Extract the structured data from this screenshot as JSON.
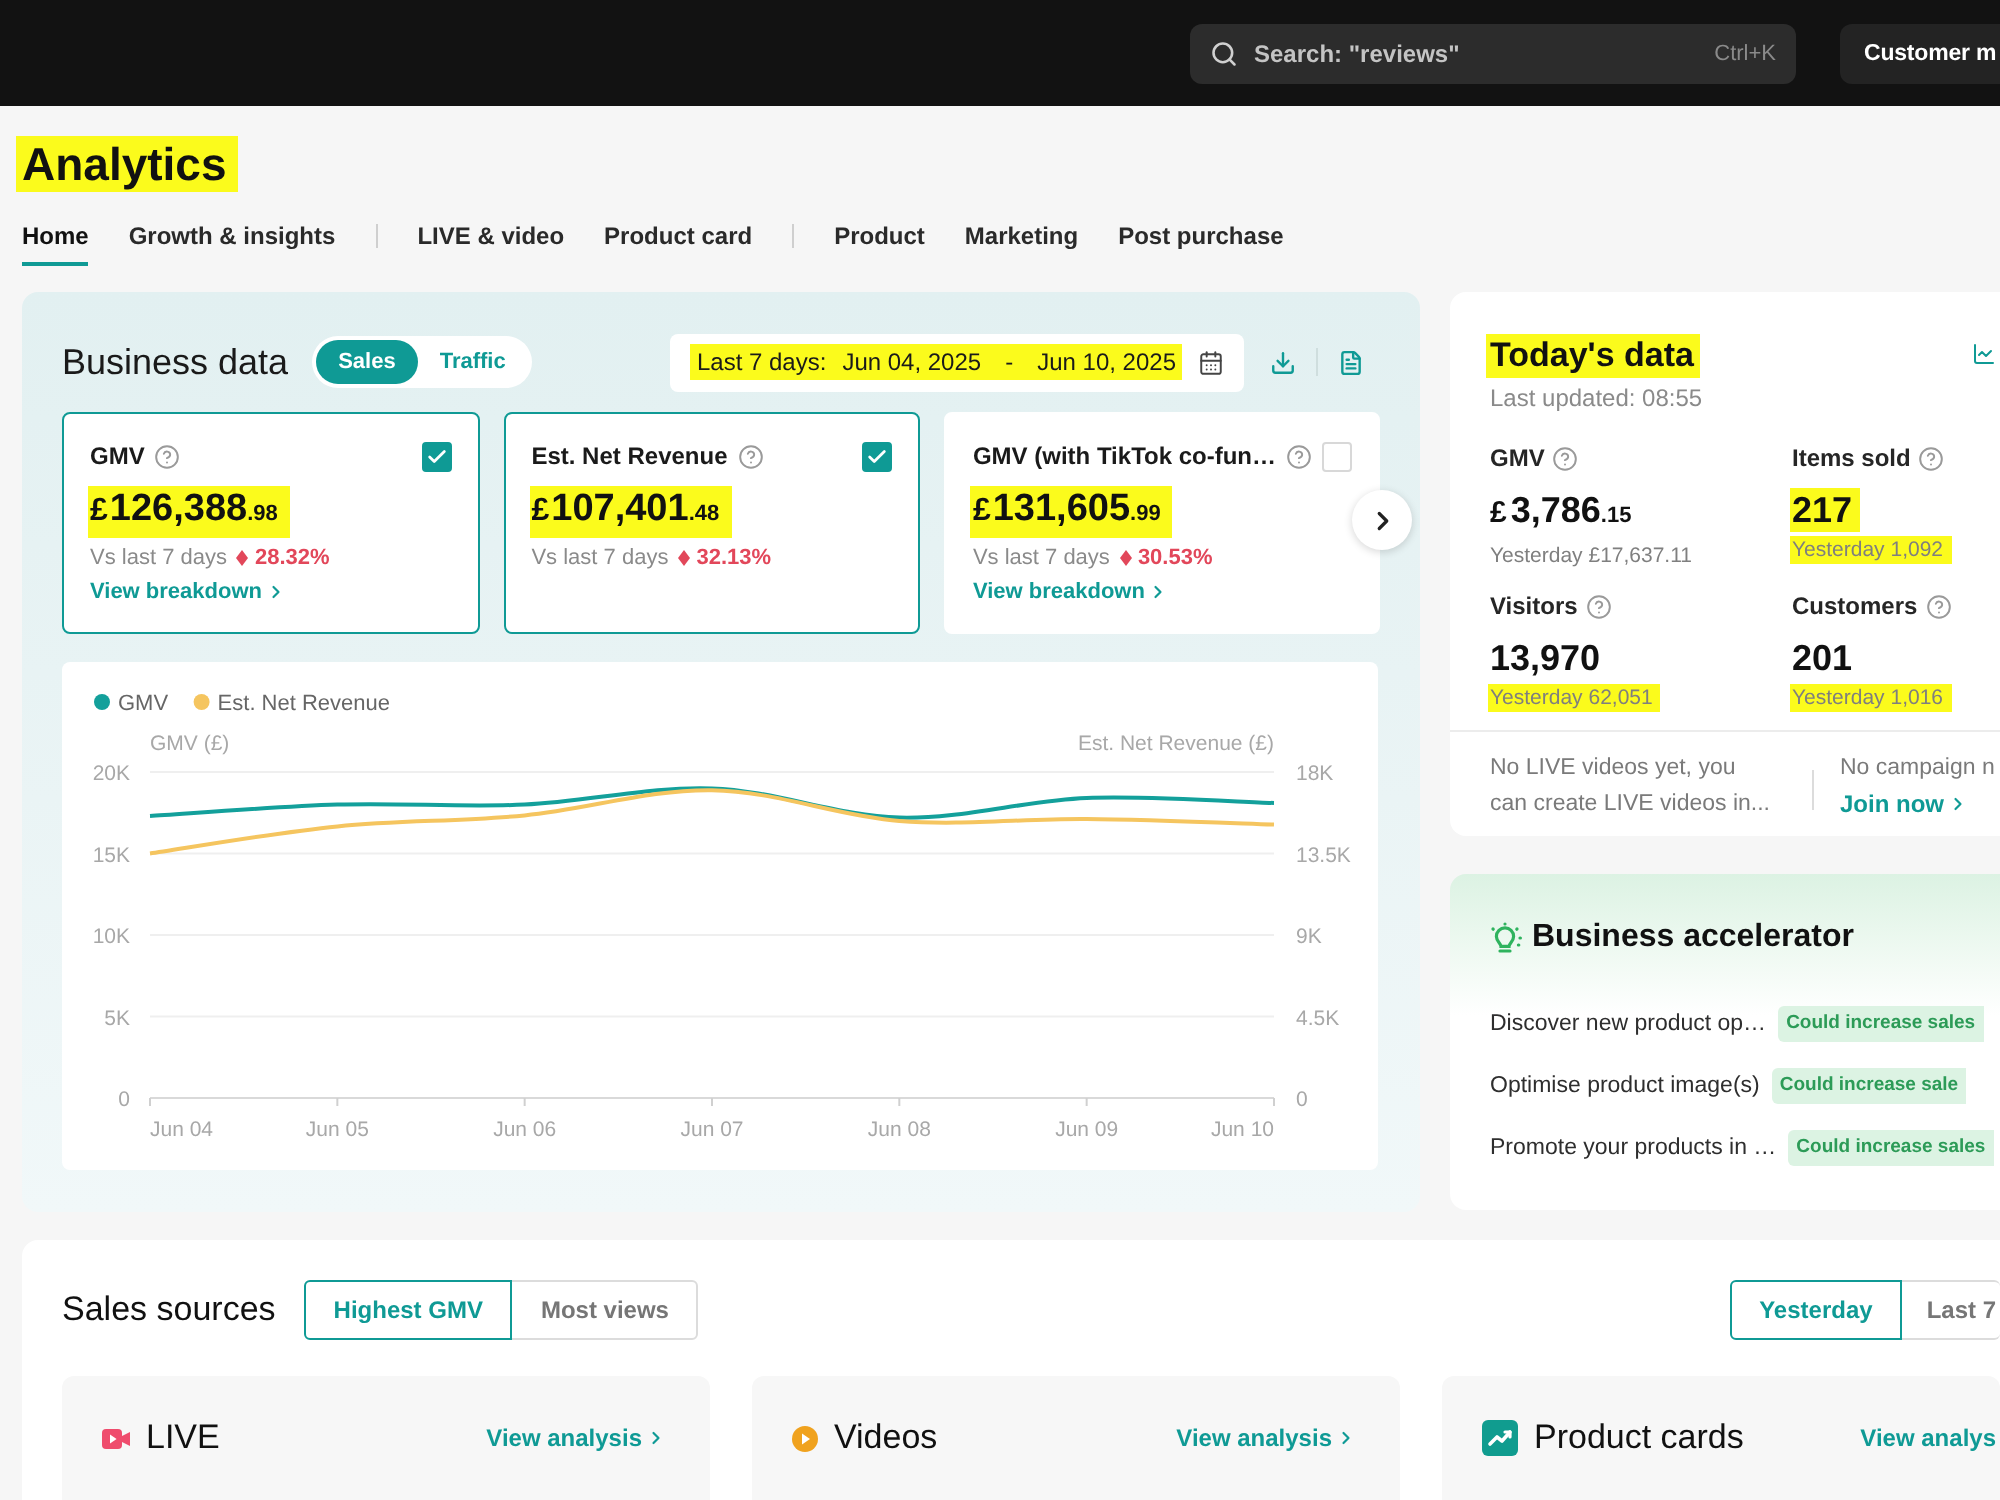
{
  "top_bar": {
    "search": {
      "placeholder": "Search: \"reviews\"",
      "shortcut": "Ctrl+K"
    },
    "button": "Customer m"
  },
  "page_title": {
    "text": "Analytics",
    "highlighted": true
  },
  "tab_groups": [
    [
      {
        "label": "Home",
        "selected": true
      },
      {
        "label": "Growth & insights",
        "selected": false
      }
    ],
    [
      {
        "label": "LIVE & video",
        "selected": false
      },
      {
        "label": "Product card",
        "selected": false
      }
    ],
    [
      {
        "label": "Product",
        "selected": false
      },
      {
        "label": "Marketing",
        "selected": false
      },
      {
        "label": "Post purchase",
        "selected": false
      }
    ]
  ],
  "business_data": {
    "title": "Business data",
    "modes": [
      {
        "label": "Sales",
        "selected": true
      },
      {
        "label": "Traffic",
        "selected": false
      }
    ],
    "date_range": {
      "label": "Last 7 days:",
      "start": "Jun 04, 2025",
      "separator": "-",
      "end": "Jun 10, 2025",
      "highlighted": true
    },
    "metrics": [
      {
        "label": "GMV",
        "currency": "£",
        "value": "126,388",
        "decimals": ".98",
        "highlighted": true,
        "comparison": "Vs last 7 days",
        "change": "28.32%",
        "link": "View breakdown",
        "checked": true
      },
      {
        "label": "Est. Net Revenue",
        "currency": "£",
        "value": "107,401",
        "decimals": ".48",
        "highlighted": true,
        "comparison": "Vs last 7 days",
        "change": "32.13%",
        "checked": true
      },
      {
        "label": "GMV (with TikTok co-fun…",
        "currency": "£",
        "value": "131,605",
        "decimals": ".99",
        "highlighted": true,
        "comparison": "Vs last 7 days",
        "change": "30.53%",
        "link": "View breakdown",
        "checked": false
      }
    ],
    "chart": {
      "chart_data": {
        "type": "line",
        "legend": "top-left",
        "grid": true,
        "categories": [
          "Jun 04",
          "Jun 05",
          "Jun 06",
          "Jun 07",
          "Jun 08",
          "Jun 09",
          "Jun 10"
        ],
        "ylabel": "GMV (£)",
        "y2label": "Est. Net Revenue (£)",
        "ylim": [
          0,
          20000
        ],
        "y2lim": [
          0,
          18000
        ],
        "yticks": [
          {
            "value": 0,
            "label": "0"
          },
          {
            "value": 5000,
            "label": "5K"
          },
          {
            "value": 10000,
            "label": "10K"
          },
          {
            "value": 15000,
            "label": "15K"
          },
          {
            "value": 20000,
            "label": "20K"
          }
        ],
        "y2ticks": [
          {
            "value": 0,
            "label": "0"
          },
          {
            "value": 4500,
            "label": "4.5K"
          },
          {
            "value": 9000,
            "label": "9K"
          },
          {
            "value": 13500,
            "label": "13.5K"
          },
          {
            "value": 18000,
            "label": "18K"
          }
        ],
        "series": [
          {
            "name": "GMV",
            "color": "#13a09b",
            "values": [
              17300,
              18000,
              18000,
              19000,
              17200,
              18400,
              18100
            ]
          },
          {
            "name": "Est. Net Revenue",
            "color": "#f5c55f",
            "axis": "y2",
            "values": [
              13500,
              15000,
              15600,
              17000,
              15300,
              15400,
              15100
            ]
          }
        ]
      }
    }
  },
  "todays_data": {
    "title": {
      "text": "Today's data",
      "highlighted": true
    },
    "updated": "Last updated: 08:55",
    "stats": [
      {
        "label": "GMV",
        "currency": "£",
        "value": "3,786",
        "decimals": ".15",
        "value_highlighted": false,
        "yesterday": "Yesterday £17,637.11",
        "yesterday_highlighted": false
      },
      {
        "label": "Items sold",
        "value": "217",
        "value_highlighted": true,
        "yesterday": "Yesterday 1,092",
        "yesterday_highlighted": true
      },
      {
        "label": "Visitors",
        "value": "13,970",
        "value_highlighted": false,
        "yesterday": "Yesterday 62,051",
        "yesterday_highlighted": true
      },
      {
        "label": "Customers",
        "value": "201",
        "value_highlighted": false,
        "yesterday": "Yesterday 1,016",
        "yesterday_highlighted": true
      }
    ],
    "notes": [
      {
        "text": "No LIVE videos yet, you can create LIVE videos in..."
      },
      {
        "text": "No campaign n",
        "link": "Join now"
      }
    ]
  },
  "business_accelerator": {
    "title": "Business accelerator",
    "items": [
      {
        "text": "Discover new product op…",
        "badge": "Could increase sales"
      },
      {
        "text": "Optimise product image(s)",
        "badge": "Could increase sale"
      },
      {
        "text": "Promote your products in …",
        "badge": "Could increase sales"
      }
    ]
  },
  "sales_sources": {
    "title": "Sales sources",
    "sort": [
      {
        "label": "Highest GMV",
        "selected": true
      },
      {
        "label": "Most views",
        "selected": false
      }
    ],
    "period": [
      {
        "label": "Yesterday",
        "selected": true
      },
      {
        "label": "Last 7",
        "selected": false
      }
    ],
    "sources": [
      {
        "kind": "live",
        "title": "LIVE",
        "link": "View analysis",
        "chevron": true
      },
      {
        "kind": "videos",
        "title": "Videos",
        "link": "View analysis",
        "chevron": true
      },
      {
        "kind": "product_cards",
        "title": "Product cards",
        "link": "View analys",
        "chevron": false
      }
    ]
  }
}
